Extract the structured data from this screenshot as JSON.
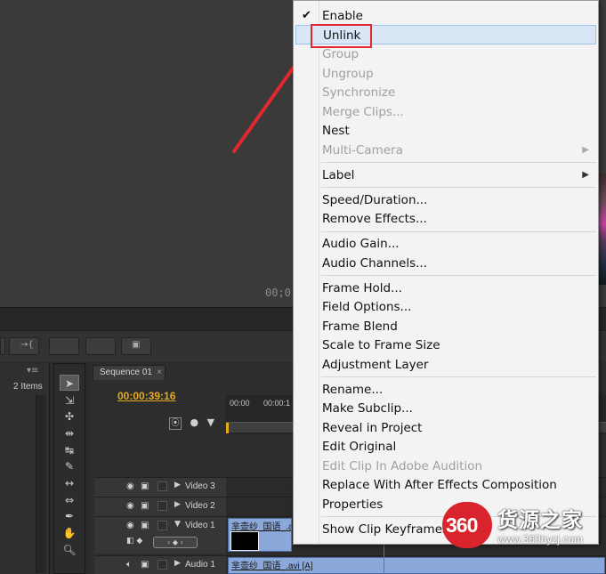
{
  "monitor": {
    "timecode": "00;0"
  },
  "project_panel": {
    "items_count": "2 Items",
    "menu_icon": "menu-icon"
  },
  "sequence": {
    "tab_label": "Sequence 01",
    "tab_close": "×",
    "timecode": "00:00:39:16",
    "ruler_labels": [
      "00:00",
      "00:00:1"
    ],
    "tracks": [
      {
        "name": "Video 3"
      },
      {
        "name": "Video 2"
      },
      {
        "name": "Video 1",
        "clip_label": "芈壶纱_国语_.a"
      },
      {
        "name": "Audio 1",
        "clip_label": "芈壶纱_国语_.avi [A]"
      }
    ]
  },
  "context_menu": {
    "items": [
      {
        "label": "Enable",
        "checked": true,
        "disabled": false
      },
      {
        "label": "Unlink",
        "disabled": false,
        "highlighted": true
      },
      {
        "label": "Group",
        "disabled": true
      },
      {
        "label": "Ungroup",
        "disabled": true
      },
      {
        "label": "Synchronize",
        "disabled": true
      },
      {
        "label": "Merge Clips...",
        "disabled": true
      },
      {
        "label": "Nest",
        "disabled": false
      },
      {
        "label": "Multi-Camera",
        "disabled": true,
        "submenu": true
      },
      {
        "label": "Label",
        "disabled": false,
        "submenu": true
      },
      {
        "label": "Speed/Duration...",
        "disabled": false
      },
      {
        "label": "Remove Effects...",
        "disabled": false
      },
      {
        "label": "Audio Gain...",
        "disabled": false
      },
      {
        "label": "Audio Channels...",
        "disabled": false
      },
      {
        "label": "Frame Hold...",
        "disabled": false
      },
      {
        "label": "Field Options...",
        "disabled": false
      },
      {
        "label": "Frame Blend",
        "disabled": false
      },
      {
        "label": "Scale to Frame Size",
        "disabled": false
      },
      {
        "label": "Adjustment Layer",
        "disabled": false
      },
      {
        "label": "Rename...",
        "disabled": false
      },
      {
        "label": "Make Subclip...",
        "disabled": false
      },
      {
        "label": "Reveal in Project",
        "disabled": false
      },
      {
        "label": "Edit Original",
        "disabled": false
      },
      {
        "label": "Edit Clip In Adobe Audition",
        "disabled": true
      },
      {
        "label": "Replace With After Effects Composition",
        "disabled": false
      },
      {
        "label": "Properties",
        "disabled": false
      },
      {
        "label": "Show Clip Keyframes",
        "disabled": false
      }
    ]
  },
  "annotation": {
    "color": "#e0282e"
  },
  "watermark": {
    "number": "360",
    "name": "货源之家",
    "url": "www.360hyzj.com"
  },
  "colors": {
    "timecode": "#e3a91e",
    "highlight": "#d8e6f5",
    "clip": "#8aa8d9"
  }
}
